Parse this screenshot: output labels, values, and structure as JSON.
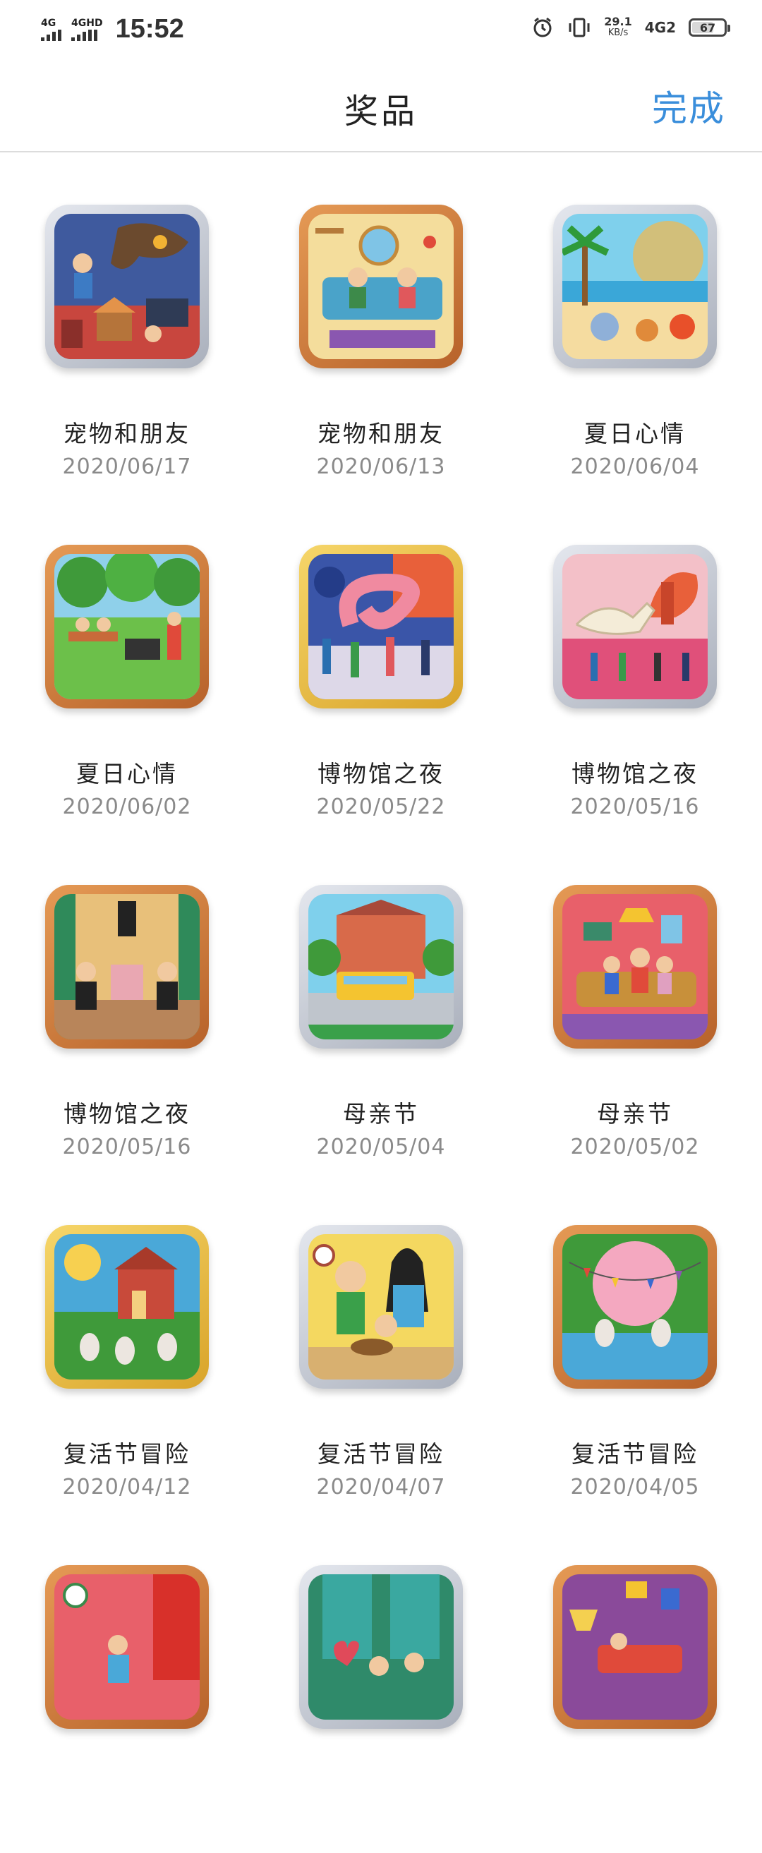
{
  "status_bar": {
    "network_left": "4G",
    "network_right": "4GHD",
    "time": "15:52",
    "speed_value": "29.1",
    "speed_unit": "KB/s",
    "signal_label": "4G2",
    "battery": "67"
  },
  "header": {
    "title": "奖品",
    "done_label": "完成"
  },
  "prizes": [
    {
      "title": "宠物和朋友",
      "date": "2020/06/17",
      "frame": "silver"
    },
    {
      "title": "宠物和朋友",
      "date": "2020/06/13",
      "frame": "bronze"
    },
    {
      "title": "夏日心情",
      "date": "2020/06/04",
      "frame": "silver"
    },
    {
      "title": "夏日心情",
      "date": "2020/06/02",
      "frame": "bronze"
    },
    {
      "title": "博物馆之夜",
      "date": "2020/05/22",
      "frame": "gold"
    },
    {
      "title": "博物馆之夜",
      "date": "2020/05/16",
      "frame": "silver"
    },
    {
      "title": "博物馆之夜",
      "date": "2020/05/16",
      "frame": "bronze"
    },
    {
      "title": "母亲节",
      "date": "2020/05/04",
      "frame": "silver"
    },
    {
      "title": "母亲节",
      "date": "2020/05/02",
      "frame": "bronze"
    },
    {
      "title": "复活节冒险",
      "date": "2020/04/12",
      "frame": "gold"
    },
    {
      "title": "复活节冒险",
      "date": "2020/04/07",
      "frame": "silver"
    },
    {
      "title": "复活节冒险",
      "date": "2020/04/05",
      "frame": "bronze"
    },
    {
      "title": "",
      "date": "",
      "frame": "bronze"
    },
    {
      "title": "",
      "date": "",
      "frame": "silver"
    },
    {
      "title": "",
      "date": "",
      "frame": "bronze"
    }
  ]
}
